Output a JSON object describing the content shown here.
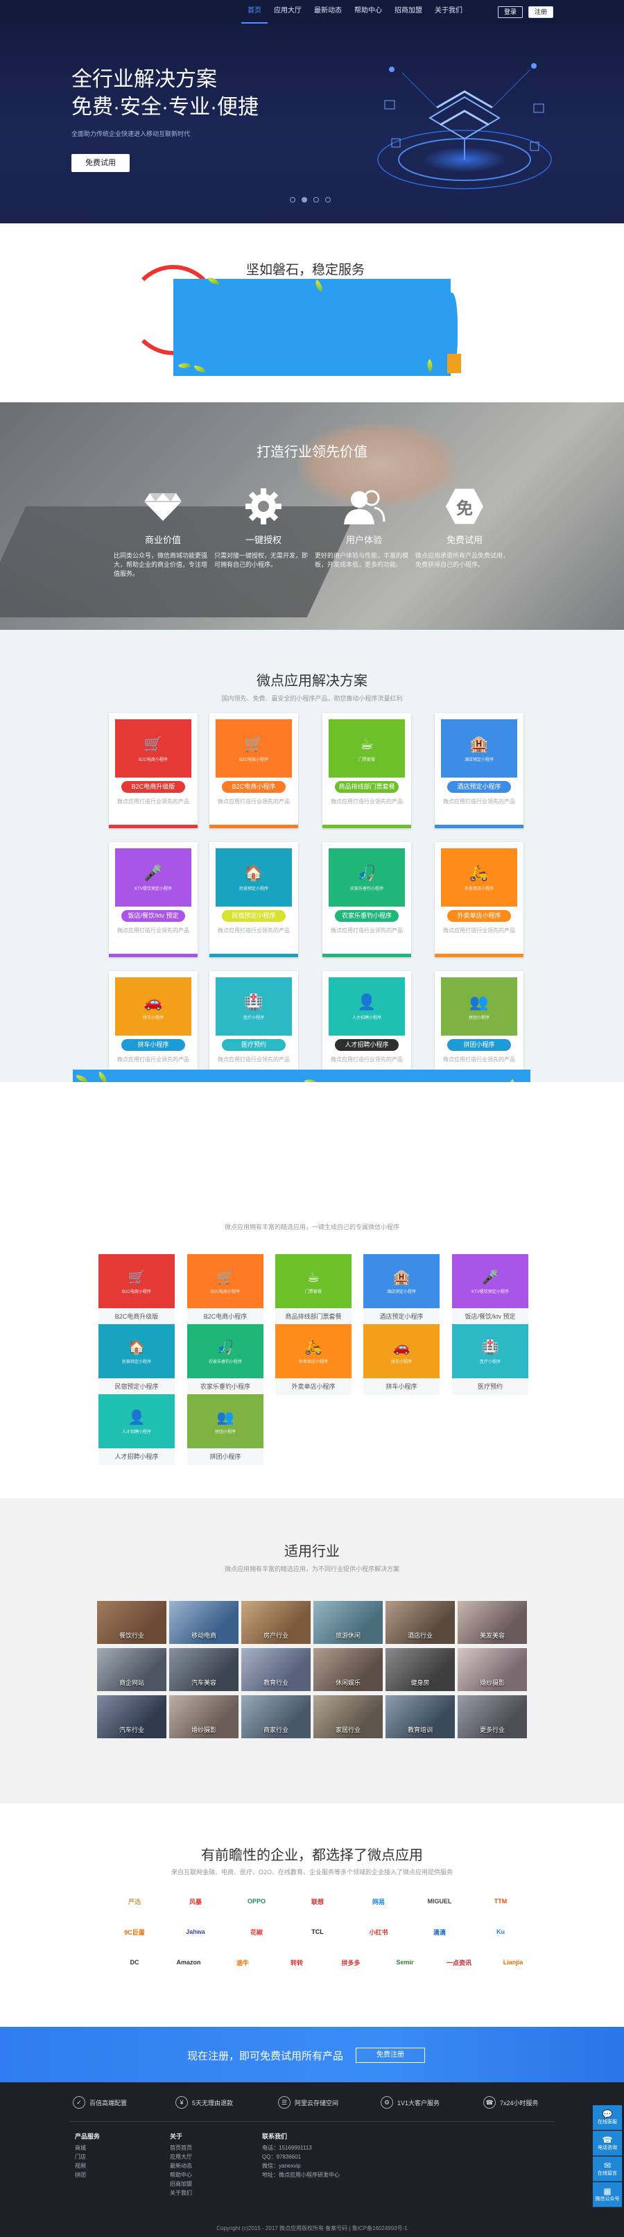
{
  "nav": {
    "items": [
      "首页",
      "应用大厅",
      "最新动态",
      "帮助中心",
      "招商加盟",
      "关于我们"
    ],
    "login": "登录",
    "register": "注册"
  },
  "hero": {
    "line1": "全行业解决方案",
    "line2": "免费·安全·专业·便捷",
    "sub": "全面助力传统企业快速进入移动互联新时代",
    "button": "免费试用"
  },
  "stable": {
    "title": "坚如磐石，稳定服务"
  },
  "value": {
    "title": "打造行业领先价值",
    "items": [
      {
        "title": "商业价值",
        "desc": "比同类公众号，微信商城功能更强大，帮助企业的商业价值，专注增值服务。"
      },
      {
        "title": "一键授权",
        "desc": "只需对接一键授权，无需开发，即可拥有自己的小程序。"
      },
      {
        "title": "用户体验",
        "desc": "更好的用户体验与性能，丰富的模板，开发成本低，更多的功能。"
      },
      {
        "title": "免费试用",
        "desc": "微点应用承诺所有产品免费试用，免费获得自己的小程序。"
      }
    ],
    "badge": "免"
  },
  "solutions": {
    "title": "微点应用解决方案",
    "sub": "国内领先、免费、最安全的小程序产品，助您推动小程序流量红利",
    "desc": "微点应用打造行业领先的产品",
    "cards": [
      {
        "label": "B2C电商升级版",
        "color": "#e53935",
        "pill": "#e53935",
        "glyph": "🛒",
        "mini": "B2C电商小程序"
      },
      {
        "label": "B2C电商小程序",
        "color": "#ff7a24",
        "pill": "#ff7a24",
        "glyph": "🛒",
        "mini": "B2C电商小程序"
      },
      {
        "label": "商品排线部门票套餐",
        "color": "#6cc02a",
        "pill": "#6cc02a",
        "glyph": "☕",
        "mini": "门票套餐"
      },
      {
        "label": "酒店预定小程序",
        "color": "#3d8de6",
        "pill": "#3d8de6",
        "glyph": "🏨",
        "mini": "酒店预定小程序"
      },
      {
        "label": "饭店/餐饮/ktv 预定",
        "color": "#a855e8",
        "pill": "#a855e8",
        "glyph": "🎤",
        "mini": "KTV餐饮预定小程序"
      },
      {
        "label": "民宿预定小程序",
        "color": "#18a3c0",
        "pill": "#d8e232",
        "glyph": "🏠",
        "mini": "民宿预定小程序"
      },
      {
        "label": "农家乐垂钓小程序",
        "color": "#20b67a",
        "pill": "#20b67a",
        "glyph": "🎣",
        "mini": "农家乐垂钓小程序"
      },
      {
        "label": "外卖单店小程序",
        "color": "#ff8c1a",
        "pill": "#ff8c1a",
        "glyph": "🛵",
        "mini": "外卖单店小程序"
      },
      {
        "label": "拼车小程序",
        "color": "#f2a019",
        "pill": "#1e9ad6",
        "glyph": "🚗",
        "mini": "拼车小程序"
      },
      {
        "label": "医疗预约",
        "color": "#2bb9c6",
        "pill": "#2bb9c6",
        "glyph": "🏥",
        "mini": "医疗小程序"
      },
      {
        "label": "人才招聘小程序",
        "color": "#1fbfb1",
        "pill": "#2f2f2f",
        "glyph": "👤",
        "mini": "人才招聘小程序"
      },
      {
        "label": "拼团小程序",
        "color": "#7cb342",
        "pill": "#1e9ad6",
        "glyph": "👥",
        "mini": "拼团小程序"
      }
    ]
  },
  "mini": {
    "sub": "微点应用拥有丰富的精选应用，一键生成自己的专属微信小程序",
    "cards": [
      {
        "label": "B2C电商升级版",
        "color": "#e53935",
        "glyph": "🛒",
        "mini": "B2C电商小程序"
      },
      {
        "label": "B2C电商小程序",
        "color": "#ff7a24",
        "glyph": "🛒",
        "mini": "B2C电商小程序"
      },
      {
        "label": "商品排线部门票套餐",
        "color": "#6cc02a",
        "glyph": "☕",
        "mini": "门票套餐"
      },
      {
        "label": "酒店预定小程序",
        "color": "#3d8de6",
        "glyph": "🏨",
        "mini": "酒店预定小程序"
      },
      {
        "label": "饭店/餐饮/ktv 预定",
        "color": "#a855e8",
        "glyph": "🎤",
        "mini": "KTV餐饮预定小程序"
      },
      {
        "label": "民宿预定小程序",
        "color": "#18a3c0",
        "glyph": "🏠",
        "mini": "民宿预定小程序"
      },
      {
        "label": "农家乐垂钓小程序",
        "color": "#20b67a",
        "glyph": "🎣",
        "mini": "农家乐垂钓小程序"
      },
      {
        "label": "外卖单店小程序",
        "color": "#ff8c1a",
        "glyph": "🛵",
        "mini": "外卖单店小程序"
      },
      {
        "label": "拼车小程序",
        "color": "#f2a019",
        "glyph": "🚗",
        "mini": "拼车小程序"
      },
      {
        "label": "医疗预约",
        "color": "#2bb9c6",
        "glyph": "🏥",
        "mini": "医疗小程序"
      },
      {
        "label": "人才招聘小程序",
        "color": "#1fbfb1",
        "glyph": "👤",
        "mini": "人才招聘小程序"
      },
      {
        "label": "拼团小程序",
        "color": "#7cb342",
        "glyph": "👥",
        "mini": "拼团小程序"
      }
    ]
  },
  "industries": {
    "title": "适用行业",
    "sub": "微点应用拥有丰富的精选应用，为不同行业提供小程序解决方案",
    "items": [
      {
        "label": "餐饮行业",
        "c1": "#6b4a36",
        "c2": "#a27b5c"
      },
      {
        "label": "移动电商",
        "c1": "#3a5f8a",
        "c2": "#9cb4cf"
      },
      {
        "label": "房产行业",
        "c1": "#7a5a3b",
        "c2": "#c9a77f"
      },
      {
        "label": "旅游休闲",
        "c1": "#4a6d7c",
        "c2": "#95b6c2"
      },
      {
        "label": "酒店行业",
        "c1": "#5a4a3e",
        "c2": "#b29b86"
      },
      {
        "label": "美发美容",
        "c1": "#6a5a5a",
        "c2": "#c8b7b0"
      },
      {
        "label": "商企网站",
        "c1": "#4c5560",
        "c2": "#a3abb4"
      },
      {
        "label": "汽车美容",
        "c1": "#3d4550",
        "c2": "#8892a0"
      },
      {
        "label": "教育行业",
        "c1": "#56627a",
        "c2": "#a6b2c6"
      },
      {
        "label": "休闲娱乐",
        "c1": "#5d4f48",
        "c2": "#b09c8e"
      },
      {
        "label": "健身房",
        "c1": "#3e3e3e",
        "c2": "#8a8a8a"
      },
      {
        "label": "婚纱摄影",
        "c1": "#7b6a70",
        "c2": "#d7c6c8"
      },
      {
        "label": "汽车行业",
        "c1": "#2f3a4d",
        "c2": "#7d8aa1"
      },
      {
        "label": "婚纱摄影",
        "c1": "#6a5d57",
        "c2": "#bfb0a6"
      },
      {
        "label": "商家行业",
        "c1": "#485869",
        "c2": "#9aa9b8"
      },
      {
        "label": "家居行业",
        "c1": "#5e564b",
        "c2": "#b1a693"
      },
      {
        "label": "教育培训",
        "c1": "#3b4a5b",
        "c2": "#8d9eb0"
      },
      {
        "label": "更多行业",
        "c1": "#4d4d55",
        "c2": "#9c9ca8"
      }
    ]
  },
  "partners": {
    "title": "有前瞻性的企业，都选择了微点应用",
    "sub": "来自互联网金融、电商、医疗、O2O、在线教育、企业服务等多个领域的企业接入了微点应用提供服务",
    "logos": [
      {
        "text": "严选",
        "color": "#c8a266"
      },
      {
        "text": "风暴",
        "color": "#e53935"
      },
      {
        "text": "OPPO",
        "color": "#1d8f4e"
      },
      {
        "text": "联想",
        "color": "#d32f2f"
      },
      {
        "text": "网易",
        "color": "#1e88e5"
      },
      {
        "text": "MIGUEL",
        "color": "#444"
      },
      {
        "text": "TTM",
        "color": "#e65100"
      },
      {
        "text": "9C巨蛋",
        "color": "#ef6c00"
      },
      {
        "text": "Jahwa",
        "color": "#3949ab"
      },
      {
        "text": "花椒",
        "color": "#e53935"
      },
      {
        "text": "TCL",
        "color": "#222"
      },
      {
        "text": "小红书",
        "color": "#e53935"
      },
      {
        "text": "滴滴",
        "color": "#1565c0"
      },
      {
        "text": "Ku",
        "color": "#1e88e5"
      },
      {
        "text": "DC",
        "color": "#333"
      },
      {
        "text": "Amazon",
        "color": "#333"
      },
      {
        "text": "途牛",
        "color": "#ff6f00"
      },
      {
        "text": "转转",
        "color": "#e53935"
      },
      {
        "text": "拼多多",
        "color": "#e53935"
      },
      {
        "text": "Semir",
        "color": "#2e7d32"
      },
      {
        "text": "一点资讯",
        "color": "#c62828"
      },
      {
        "text": "Lianjia",
        "color": "#ef6c00"
      }
    ]
  },
  "cta": {
    "text": "现在注册，即可免费试用所有产品",
    "button": "免费注册"
  },
  "footer": {
    "features": [
      {
        "icon": "✓",
        "text": "百倍高端配置"
      },
      {
        "icon": "¥",
        "text": "5天无理由退款"
      },
      {
        "icon": "☰",
        "text": "阿里云存储空间"
      },
      {
        "icon": "⚙",
        "text": "1V1大客户服务"
      },
      {
        "icon": "☎",
        "text": "7x24小时服务"
      }
    ],
    "col1": {
      "title": "产品服务",
      "items": [
        "商城",
        "门店",
        "视频",
        "拼团"
      ]
    },
    "col2": {
      "title": "关于",
      "items": [
        "首页首页",
        "应用大厅",
        "最新动态",
        "帮助中心",
        "招商加盟",
        "关于我们"
      ]
    },
    "col3": {
      "title": "联系我们",
      "items": [
        "电话：15169991113",
        "QQ：97836601",
        "微信：yanexvip",
        "地址：微点应用小程序研发中心"
      ]
    },
    "copyright": "Copyright (c)2015 - 2017 微点应用版权所有 备案号码 | 鲁ICP备16024993号-1"
  },
  "side": [
    {
      "glyph": "💬",
      "label": "在线客服"
    },
    {
      "glyph": "☎",
      "label": "电话咨询"
    },
    {
      "glyph": "✉",
      "label": "在线留言"
    },
    {
      "glyph": "▦",
      "label": "微信公众号"
    }
  ]
}
